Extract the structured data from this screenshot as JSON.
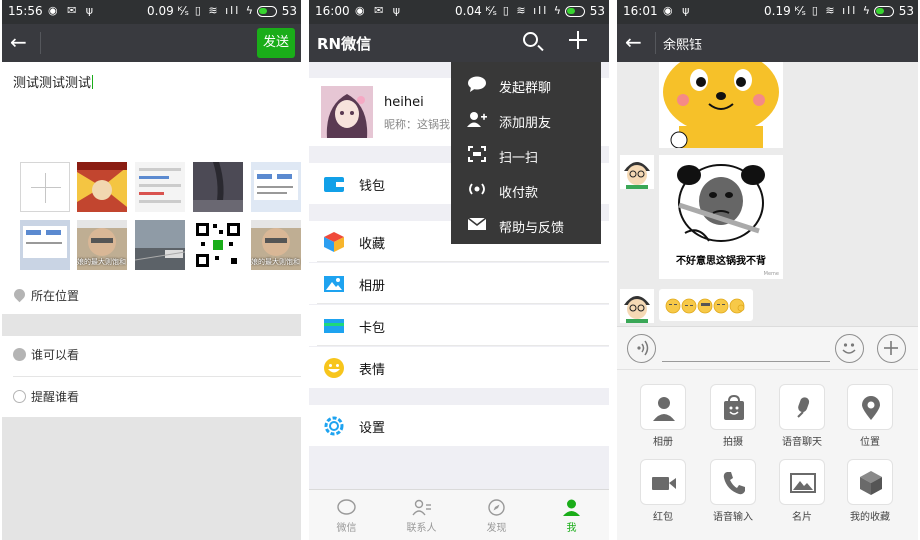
{
  "panel1": {
    "status": {
      "time": "15:56",
      "speed": "0.09 ᴷ⁄ₛ",
      "battery": "53"
    },
    "toolbar": {
      "back": "←",
      "send_label": "发送"
    },
    "compose": {
      "text": "测试测试测试"
    },
    "thumbs": [
      {
        "overlay": ""
      },
      {
        "overlay": ""
      },
      {
        "overlay": ""
      },
      {
        "overlay": ""
      },
      {
        "overlay": ""
      },
      {
        "overlay": ""
      },
      {
        "overlay": "娘的最大则饱和"
      },
      {
        "overlay": ""
      },
      {
        "overlay": ""
      },
      {
        "overlay": "娘的最大则饱和"
      }
    ],
    "rows": {
      "location": "所在位置",
      "who_can_see": "谁可以看",
      "remind": "提醒谁看"
    }
  },
  "panel2": {
    "status": {
      "time": "16:00",
      "speed": "0.04 ᴷ⁄ₛ",
      "battery": "53"
    },
    "title": "RN微信",
    "profile": {
      "name": "heihei",
      "subtitle": "昵称：这锅我"
    },
    "menu": {
      "wallet": "钱包",
      "favorites": "收藏",
      "album": "相册",
      "cards": "卡包",
      "stickers": "表情",
      "settings": "设置"
    },
    "popup": [
      {
        "label": "发起群聊",
        "icon": "chat-bubble-icon"
      },
      {
        "label": "添加朋友",
        "icon": "add-friend-icon"
      },
      {
        "label": "扫一扫",
        "icon": "scan-icon"
      },
      {
        "label": "收付款",
        "icon": "payment-icon"
      },
      {
        "label": "帮助与反馈",
        "icon": "mail-icon"
      }
    ],
    "tabs": [
      {
        "label": "微信",
        "icon": "chat-icon"
      },
      {
        "label": "联系人",
        "icon": "contacts-icon"
      },
      {
        "label": "发现",
        "icon": "compass-icon"
      },
      {
        "label": "我",
        "icon": "person-icon"
      }
    ],
    "colors": {
      "accent": "#1aad19",
      "toolbar": "#393a3f"
    }
  },
  "panel3": {
    "status": {
      "time": "16:01",
      "speed": "0.19 ᴷ⁄ₛ",
      "battery": "53"
    },
    "title": "余熙钰",
    "sticker_caption": "不好意思这锅我不背",
    "sticker_watermark": "Meme",
    "apps": [
      {
        "label": "相册",
        "icon": "person-icon"
      },
      {
        "label": "拍摄",
        "icon": "camera-bag-icon"
      },
      {
        "label": "语音聊天",
        "icon": "mic-icon"
      },
      {
        "label": "位置",
        "icon": "location-icon"
      },
      {
        "label": "红包",
        "icon": "video-icon"
      },
      {
        "label": "语音输入",
        "icon": "phone-icon"
      },
      {
        "label": "名片",
        "icon": "image-icon"
      },
      {
        "label": "我的收藏",
        "icon": "cube-icon"
      }
    ]
  }
}
